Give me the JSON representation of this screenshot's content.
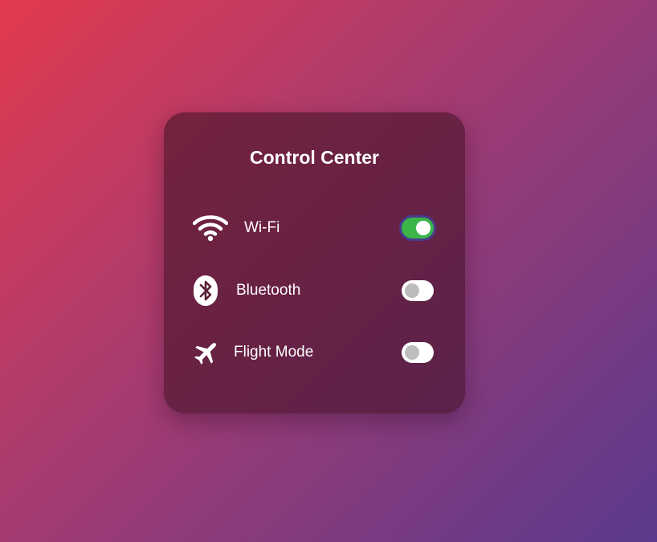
{
  "panel": {
    "title": "Control Center"
  },
  "settings": [
    {
      "label": "Wi-Fi",
      "icon": "wifi-icon",
      "enabled": true
    },
    {
      "label": "Bluetooth",
      "icon": "bluetooth-icon",
      "enabled": false
    },
    {
      "label": "Flight Mode",
      "icon": "airplane-icon",
      "enabled": false
    }
  ],
  "colors": {
    "toggle_on": "#3bb54a",
    "toggle_off": "#ffffff",
    "knob_off": "#bdbdbd"
  }
}
